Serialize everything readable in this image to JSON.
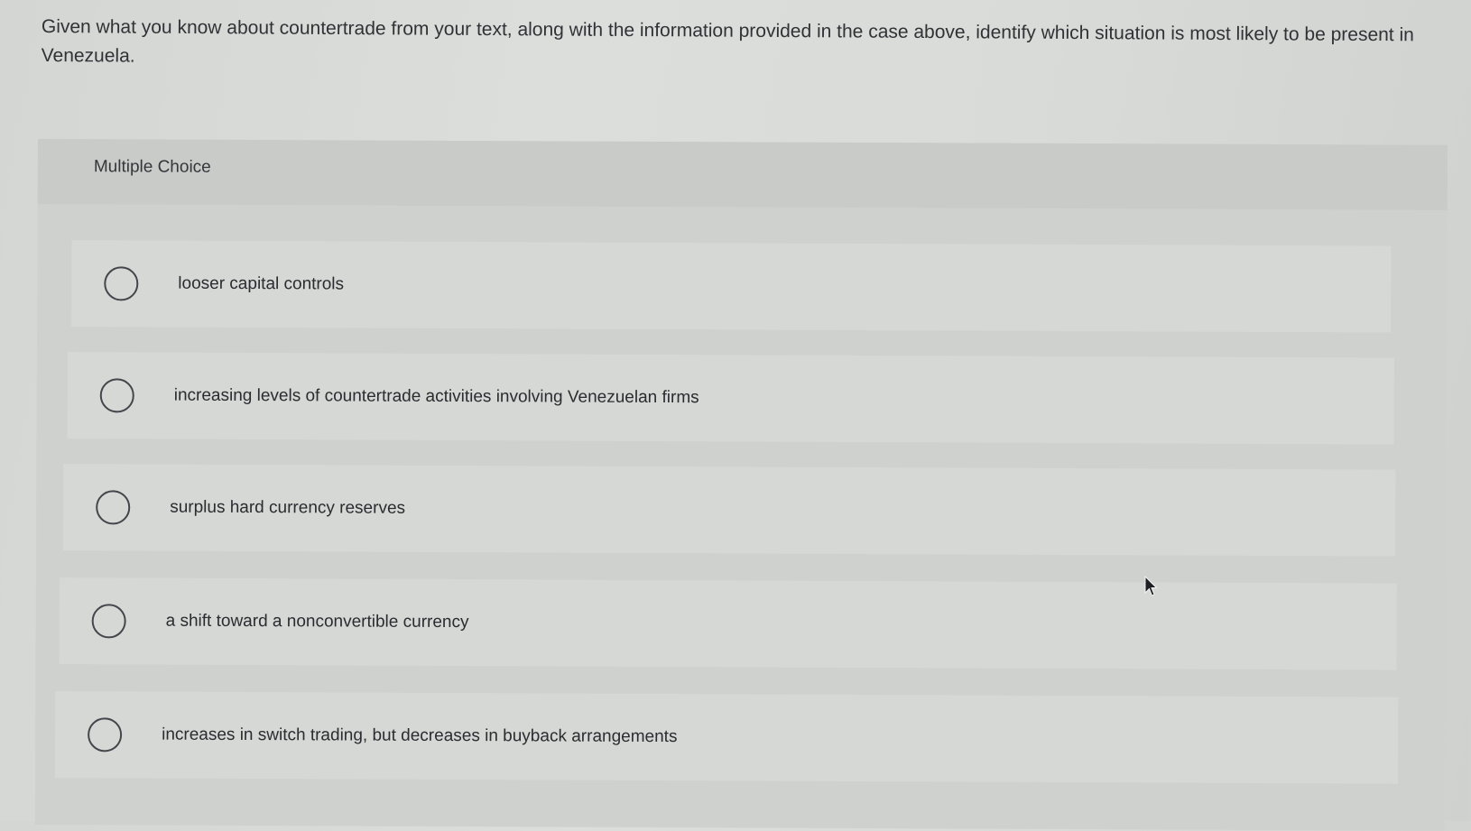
{
  "question": {
    "text": "Given what you know about countertrade from your text, along with the information provided in the case above, identify which situation is most likely to be present in Venezuela."
  },
  "panel": {
    "title": "Multiple Choice"
  },
  "options": [
    {
      "label": "looser capital controls"
    },
    {
      "label": "increasing levels of countertrade activities involving Venezuelan firms"
    },
    {
      "label": "surplus hard currency reserves"
    },
    {
      "label": "a shift toward a nonconvertible currency"
    },
    {
      "label": "increases in switch trading, but decreases in buyback arrangements"
    }
  ]
}
